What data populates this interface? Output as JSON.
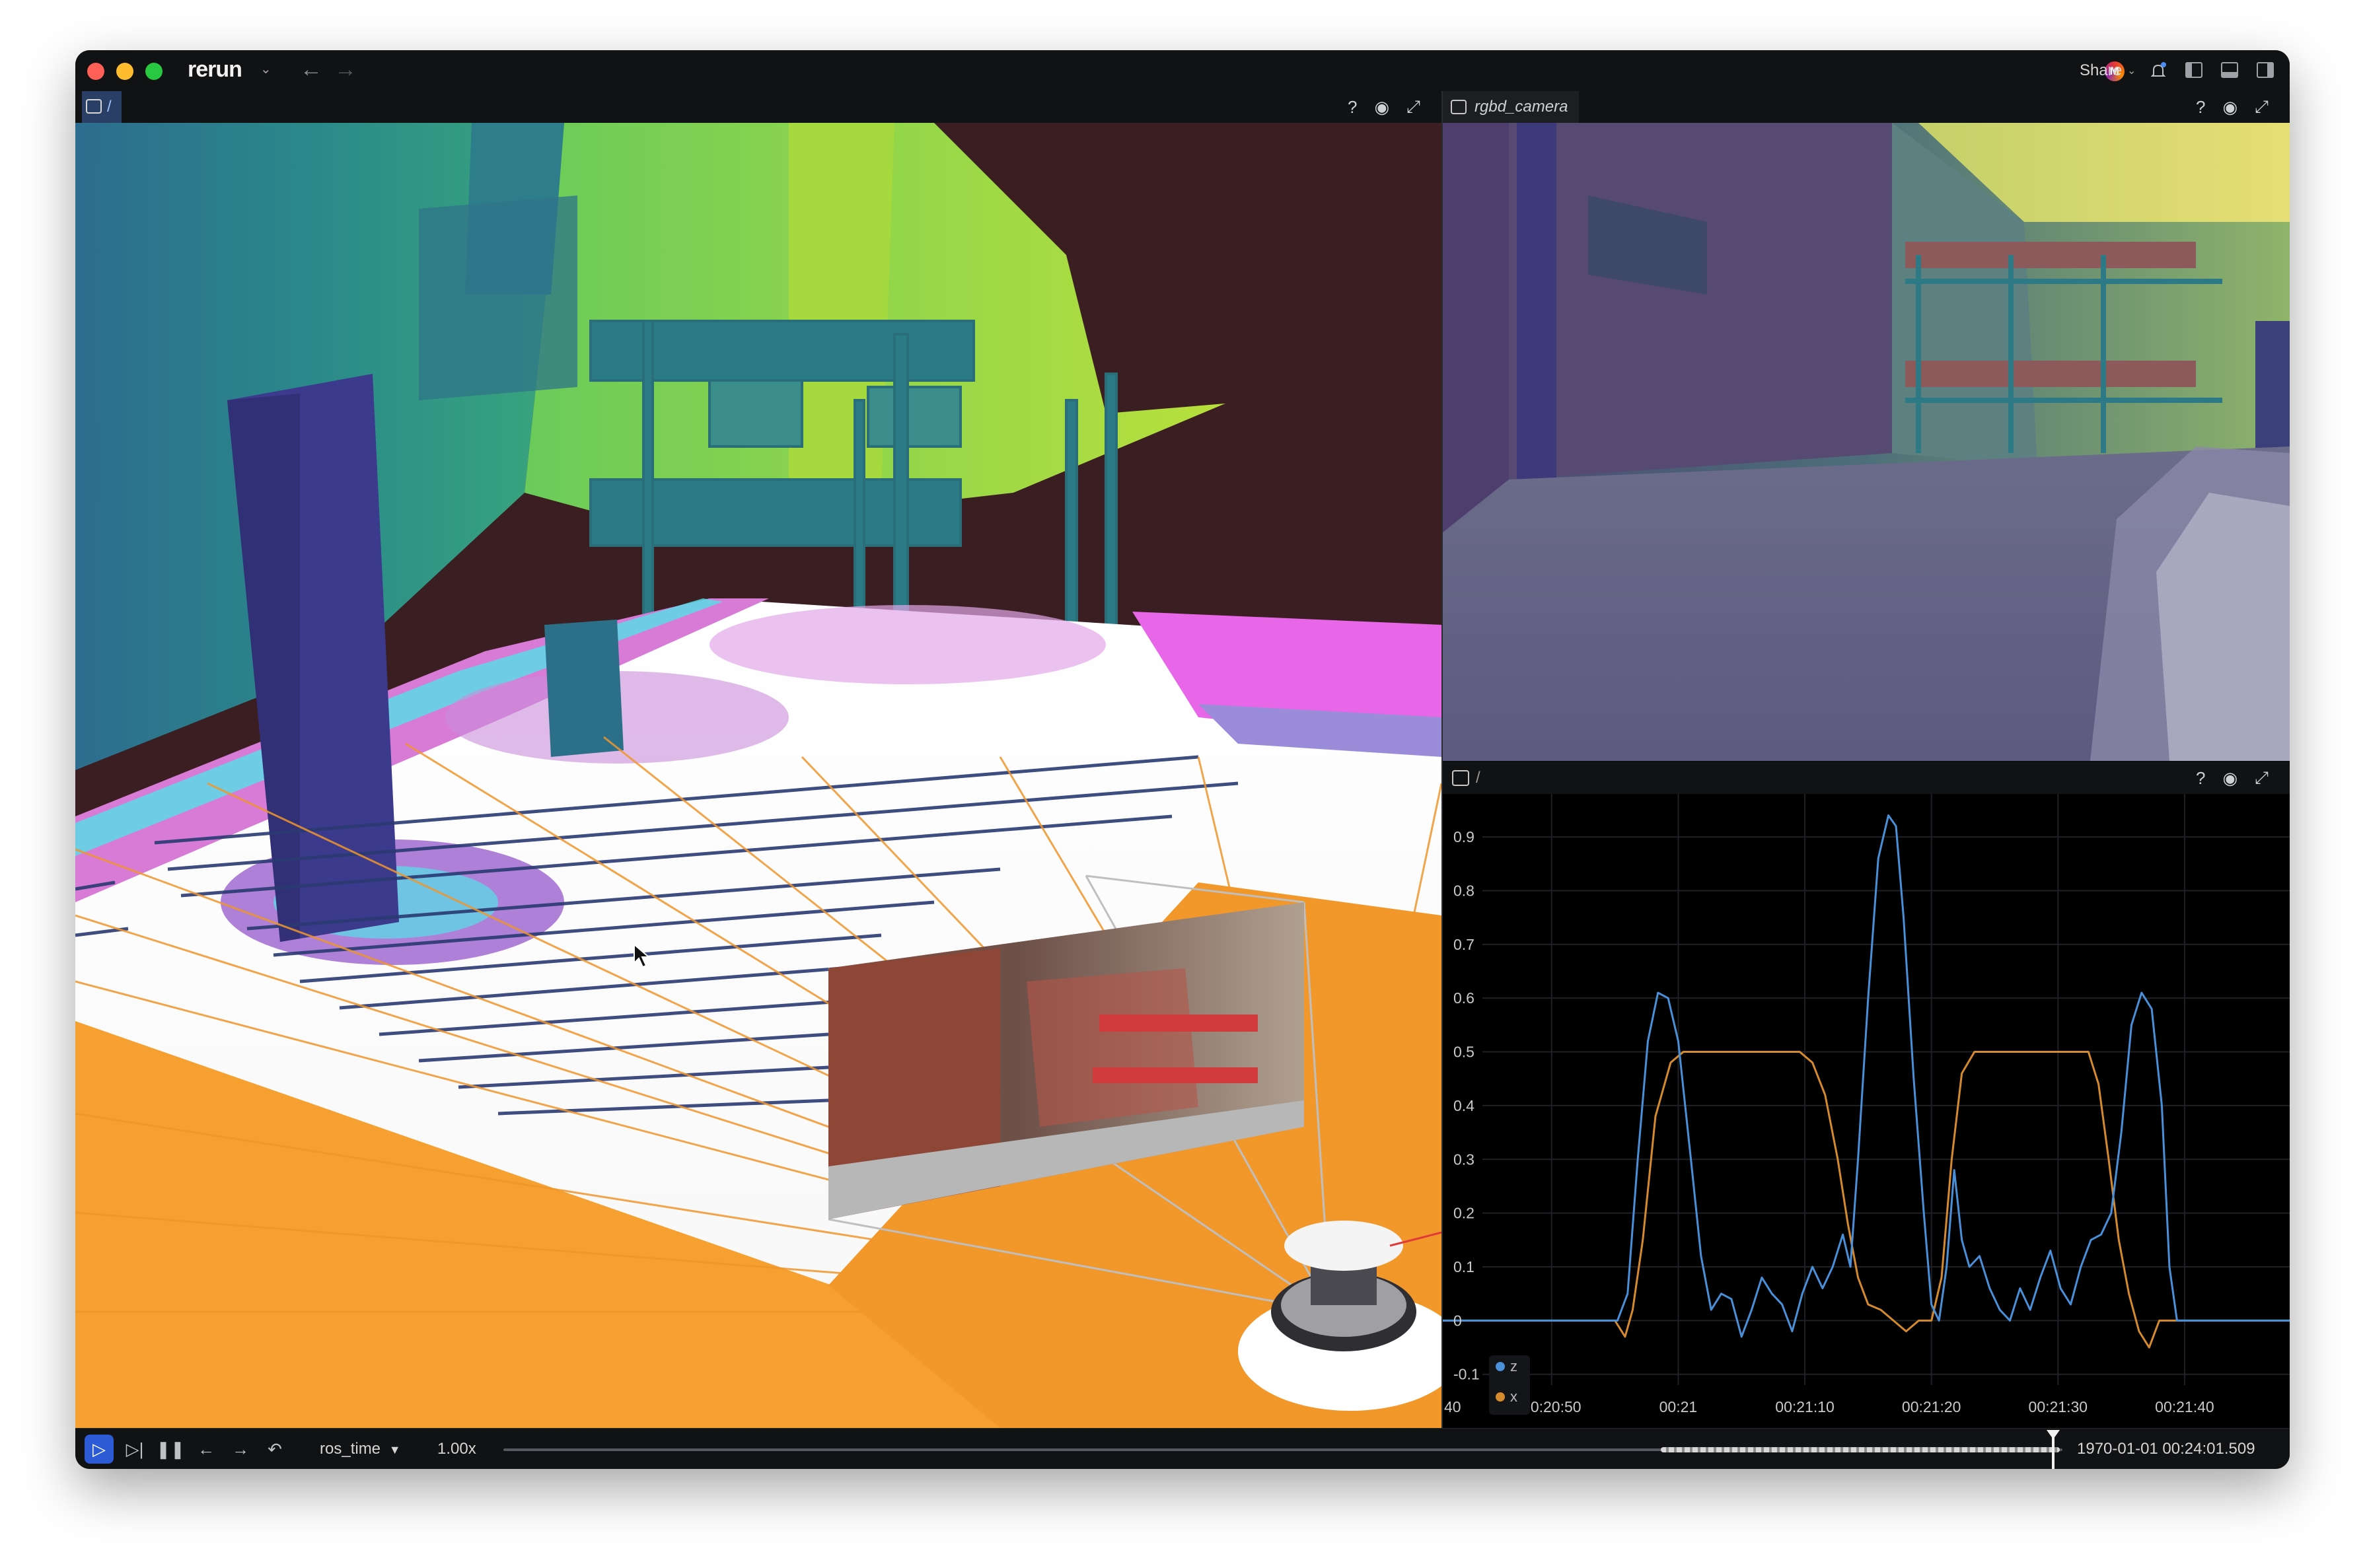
{
  "app": {
    "logo": "rerun",
    "share_label": "Share",
    "avatar_initial": "M"
  },
  "view3d": {
    "path_label": "/",
    "help_label": "?"
  },
  "camera_view": {
    "title": "rgbd_camera",
    "help_label": "?"
  },
  "plot_view": {
    "path_label": "/",
    "help_label": "?",
    "y_ticks": [
      "0.9",
      "0.8",
      "0.7",
      "0.6",
      "0.5",
      "0.4",
      "0.3",
      "0.2",
      "0.1",
      "0",
      "-0.1"
    ],
    "x_ticks": [
      "40",
      "00:20:50",
      "00:21",
      "00:21:10",
      "00:21:20",
      "00:21:30",
      "00:21:40"
    ],
    "legend": [
      {
        "name": "z",
        "color": "#4a90d9"
      },
      {
        "name": "x",
        "color": "#d58a2e"
      }
    ]
  },
  "chart_data": {
    "type": "line",
    "x_unit": "seconds from 00:20:50",
    "ylim": [
      -0.12,
      0.98
    ],
    "xlim": [
      -8.6,
      58.3
    ],
    "grid": true,
    "legend_placement": "bottom-left",
    "series": [
      {
        "name": "z",
        "color": "#4a90d9",
        "points": [
          [
            -8.6,
            0
          ],
          [
            5.2,
            0
          ],
          [
            6.0,
            0.05
          ],
          [
            6.8,
            0.3
          ],
          [
            7.6,
            0.52
          ],
          [
            8.4,
            0.61
          ],
          [
            9.2,
            0.6
          ],
          [
            10.0,
            0.52
          ],
          [
            11.0,
            0.3
          ],
          [
            11.8,
            0.12
          ],
          [
            12.6,
            0.02
          ],
          [
            13.4,
            0.05
          ],
          [
            14.2,
            0.04
          ],
          [
            15.0,
            -0.03
          ],
          [
            15.8,
            0.02
          ],
          [
            16.6,
            0.08
          ],
          [
            17.4,
            0.05
          ],
          [
            18.2,
            0.03
          ],
          [
            19.0,
            -0.02
          ],
          [
            19.8,
            0.05
          ],
          [
            20.6,
            0.1
          ],
          [
            21.4,
            0.06
          ],
          [
            22.2,
            0.1
          ],
          [
            23.0,
            0.16
          ],
          [
            23.6,
            0.1
          ],
          [
            24.2,
            0.3
          ],
          [
            25.0,
            0.6
          ],
          [
            25.8,
            0.86
          ],
          [
            26.6,
            0.94
          ],
          [
            27.2,
            0.92
          ],
          [
            27.8,
            0.75
          ],
          [
            28.6,
            0.45
          ],
          [
            29.4,
            0.2
          ],
          [
            30.0,
            0.03
          ],
          [
            30.6,
            0.0
          ],
          [
            31.2,
            0.1
          ],
          [
            31.8,
            0.28
          ],
          [
            32.4,
            0.15
          ],
          [
            33.0,
            0.1
          ],
          [
            33.8,
            0.12
          ],
          [
            34.6,
            0.06
          ],
          [
            35.4,
            0.02
          ],
          [
            36.2,
            0.0
          ],
          [
            37.0,
            0.06
          ],
          [
            37.8,
            0.02
          ],
          [
            38.6,
            0.08
          ],
          [
            39.4,
            0.13
          ],
          [
            40.2,
            0.06
          ],
          [
            41.0,
            0.03
          ],
          [
            41.8,
            0.1
          ],
          [
            42.6,
            0.15
          ],
          [
            43.4,
            0.16
          ],
          [
            44.2,
            0.2
          ],
          [
            45.0,
            0.35
          ],
          [
            45.8,
            0.55
          ],
          [
            46.6,
            0.61
          ],
          [
            47.4,
            0.58
          ],
          [
            48.2,
            0.4
          ],
          [
            48.8,
            0.1
          ],
          [
            49.4,
            0.0
          ],
          [
            58.3,
            0
          ]
        ]
      },
      {
        "name": "x",
        "color": "#d58a2e",
        "points": [
          [
            -8.6,
            0
          ],
          [
            5.0,
            0
          ],
          [
            5.8,
            -0.03
          ],
          [
            6.4,
            0.02
          ],
          [
            7.2,
            0.15
          ],
          [
            8.2,
            0.38
          ],
          [
            9.4,
            0.48
          ],
          [
            10.4,
            0.5
          ],
          [
            15.0,
            0.5
          ],
          [
            19.6,
            0.5
          ],
          [
            20.6,
            0.48
          ],
          [
            21.6,
            0.42
          ],
          [
            22.6,
            0.3
          ],
          [
            23.4,
            0.18
          ],
          [
            24.2,
            0.08
          ],
          [
            25.0,
            0.03
          ],
          [
            26.0,
            0.02
          ],
          [
            27.0,
            0.0
          ],
          [
            28.0,
            -0.02
          ],
          [
            29.0,
            0.0
          ],
          [
            30.0,
            0.0
          ],
          [
            30.8,
            0.08
          ],
          [
            31.6,
            0.3
          ],
          [
            32.4,
            0.46
          ],
          [
            33.4,
            0.5
          ],
          [
            38.0,
            0.5
          ],
          [
            42.4,
            0.5
          ],
          [
            43.2,
            0.44
          ],
          [
            44.0,
            0.3
          ],
          [
            44.8,
            0.15
          ],
          [
            45.6,
            0.05
          ],
          [
            46.4,
            -0.02
          ],
          [
            47.2,
            -0.05
          ],
          [
            48.0,
            0.0
          ],
          [
            58.3,
            0
          ]
        ]
      }
    ]
  },
  "timeline": {
    "timeline_name": "ros_time",
    "speed": "1.00x",
    "timestamp": "1970-01-01 00:24:01.509 458Z"
  }
}
